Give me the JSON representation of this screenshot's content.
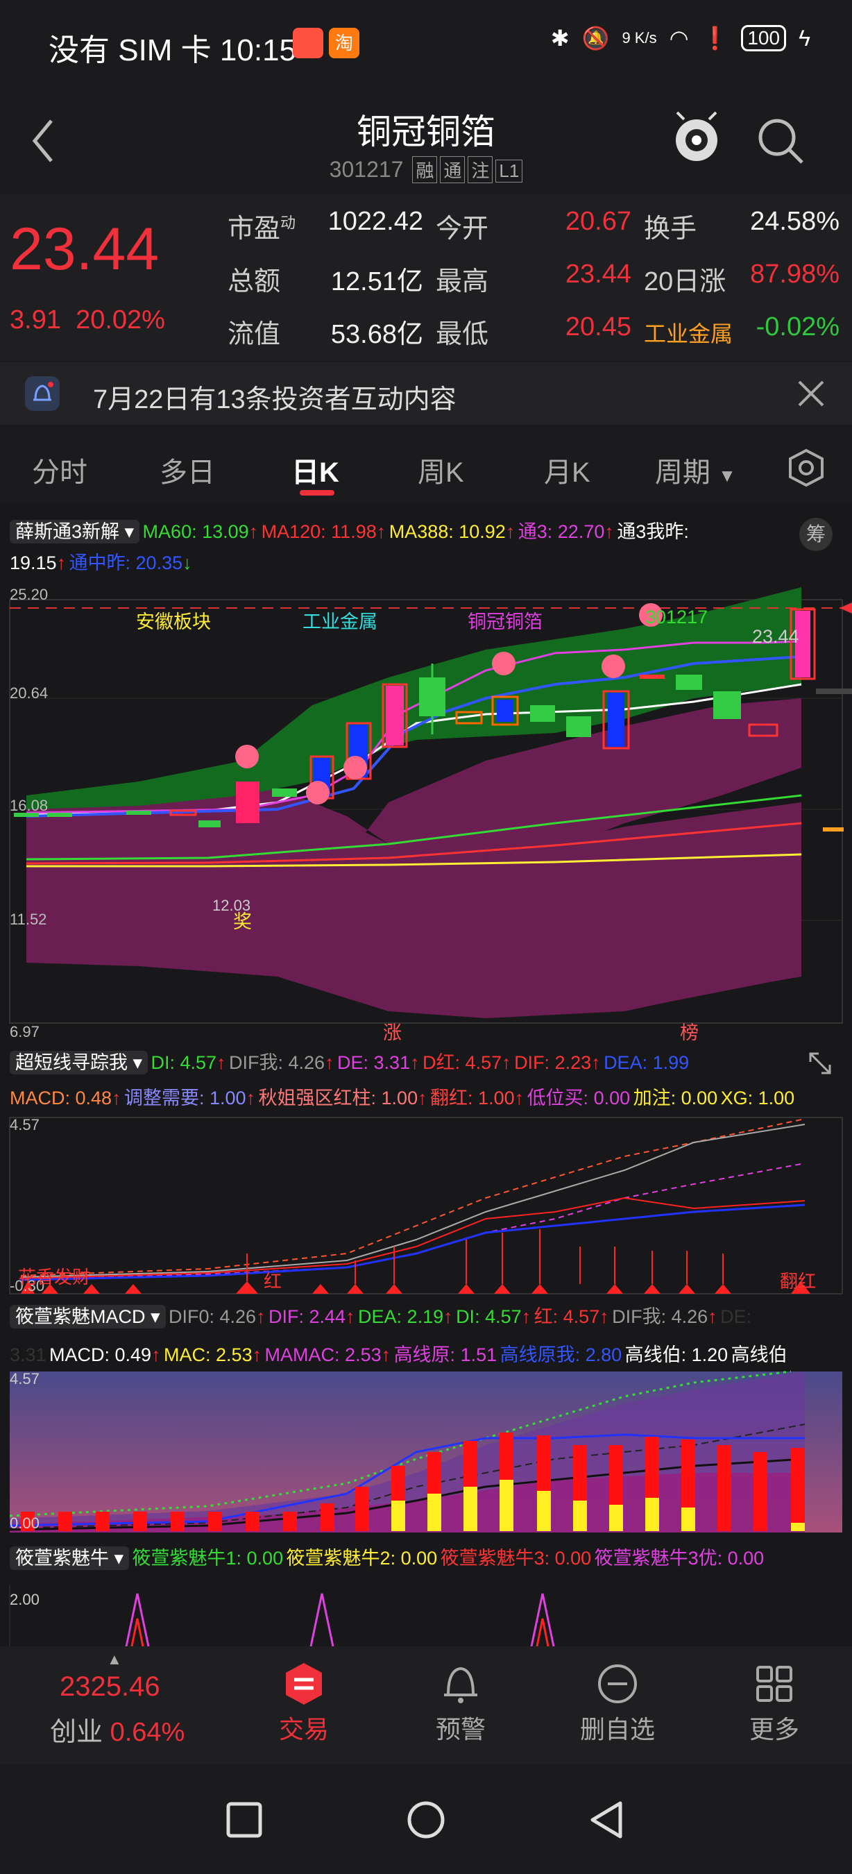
{
  "status_bar": {
    "left_text": "没有 SIM 卡 10:15",
    "network_speed": "9 K/s",
    "battery": "100"
  },
  "header": {
    "back_icon": "chevron-left-icon",
    "title": "铜冠铜箔",
    "code": "301217",
    "tags": [
      "融",
      "通",
      "注",
      "L1"
    ]
  },
  "quote": {
    "price": "23.44",
    "change": "3.91",
    "change_pct": "20.02%",
    "rows": [
      {
        "l1": "市盈",
        "sup": "动",
        "v1": "1022.42",
        "l2": "今开",
        "v2": "20.67",
        "l3": "换手",
        "v3": "24.58%"
      },
      {
        "l1": "总额",
        "v1": "12.51亿",
        "l2": "最高",
        "v2": "23.44",
        "l3": "20日涨",
        "v3": "87.98%"
      },
      {
        "l1": "流值",
        "v1": "53.68亿",
        "l2": "最低",
        "v2": "20.45",
        "l3": "工业金属",
        "v3": "-0.02%"
      }
    ]
  },
  "notice": {
    "text": "7月22日有13条投资者互动内容"
  },
  "tabs": [
    "分时",
    "多日",
    "日K",
    "周K",
    "月K",
    "周期"
  ],
  "main_panel": {
    "indicator": "薛斯通3新解",
    "legend": [
      {
        "text": "MA60: 13.09",
        "color": "#33dd33"
      },
      {
        "text": "MA120: 11.98",
        "color": "#ff3333"
      },
      {
        "text": "MA388: 10.92",
        "color": "#ffee33"
      },
      {
        "text": "通3: 22.70",
        "color": "#e040e0"
      },
      {
        "text": "通3我昨:",
        "color": "#ffffff"
      },
      {
        "text": "19.15",
        "color": "#ffffff"
      },
      {
        "text": "通中昨: 20.35",
        "color": "#3355ff"
      }
    ],
    "chou": "筹",
    "y_labels": [
      "25.20",
      "20.64",
      "16.08",
      "11.52",
      "6.97"
    ],
    "sector_labels": [
      {
        "text": "安徽板块",
        "color": "#ffee33"
      },
      {
        "text": "工业金属",
        "color": "#33dddd"
      },
      {
        "text": "铜冠铜箔",
        "color": "#e040e0"
      },
      {
        "text": "301217",
        "color": "#33dd33"
      }
    ],
    "last_price_label": "23.44",
    "low_label": "12.03",
    "award_label": "奖",
    "marker_zhang": "涨",
    "marker_bang": "榜"
  },
  "panel2": {
    "indicator": "超短线寻踪我",
    "legend1": [
      {
        "text": "DI: 4.57",
        "color": "#33dd33"
      },
      {
        "text": "DIF我: 4.26",
        "color": "#999999"
      },
      {
        "text": "DE: 3.31",
        "color": "#e040e0"
      },
      {
        "text": "D红: 4.57",
        "color": "#ff3333"
      },
      {
        "text": "DIF: 2.23",
        "color": "#ff3333"
      },
      {
        "text": "DEA: 1.99",
        "color": "#3355ff"
      }
    ],
    "legend2": [
      {
        "text": "MACD: 0.48",
        "color": "#ff8844"
      },
      {
        "text": "调整需要: 1.00",
        "color": "#8888ff"
      },
      {
        "text": "秋姐强区红柱: 1.00",
        "color": "#ff7777"
      },
      {
        "text": "翻红: 1.00",
        "color": "#ff4444"
      },
      {
        "text": "低位买: 0.00",
        "color": "#e040e0"
      },
      {
        "text": "加注: 0.00",
        "color": "#ffee33"
      },
      {
        "text": "XG: 1.00",
        "color": "#ffee33"
      }
    ],
    "y_top": "4.57",
    "y_bottom": "-0.30",
    "text_bl": "花香发财",
    "text_red": "红",
    "text_fanhong": "翻红"
  },
  "panel3": {
    "indicator": "筱萱紫魅MACD",
    "legend1": [
      {
        "text": "DIF0: 4.26",
        "color": "#999999"
      },
      {
        "text": "DIF: 2.44",
        "color": "#e040e0"
      },
      {
        "text": "DEA: 2.19",
        "color": "#33dd33"
      },
      {
        "text": "DI: 4.57",
        "color": "#33dd33"
      },
      {
        "text": "红: 4.57",
        "color": "#ff3333"
      },
      {
        "text": "DIF我: 4.26",
        "color": "#999999"
      },
      {
        "text": "DE:",
        "color": "#333333"
      }
    ],
    "legend2": [
      {
        "text": "3.31",
        "color": "#333333"
      },
      {
        "text": "MACD: 0.49",
        "color": "#ffffff"
      },
      {
        "text": "MAC: 2.53",
        "color": "#ffee33"
      },
      {
        "text": "MAMAC: 2.53",
        "color": "#e040e0"
      },
      {
        "text": "高线原: 1.51",
        "color": "#e040e0"
      },
      {
        "text": "高线原我: 2.80",
        "color": "#3355ff"
      },
      {
        "text": "高线伯: 1.20",
        "color": "#ffffff"
      },
      {
        "text": "高线伯",
        "color": "#ffffff"
      }
    ],
    "y_top": "4.57",
    "y_bottom": "0.00"
  },
  "panel4": {
    "indicator": "筱萱紫魅牛",
    "legend": [
      {
        "text": "筱萱紫魅牛1: 0.00",
        "color": "#33dd33"
      },
      {
        "text": "筱萱紫魅牛2: 0.00",
        "color": "#ffee33"
      },
      {
        "text": "筱萱紫魅牛3: 0.00",
        "color": "#ff3333"
      },
      {
        "text": "筱萱紫魅牛3优: 0.00",
        "color": "#e040e0"
      }
    ],
    "y_top": "2.00"
  },
  "bottom_nav": {
    "index_value": "2325.46",
    "index_name": "创业",
    "index_pct": "0.64%",
    "items": [
      {
        "label": "交易",
        "icon": "trade-icon"
      },
      {
        "label": "预警",
        "icon": "bell-icon"
      },
      {
        "label": "删自选",
        "icon": "minus-circle-icon"
      },
      {
        "label": "更多",
        "icon": "grid-icon"
      }
    ]
  },
  "colors": {
    "up": "#f0303a",
    "down": "#2fc93f",
    "accent": "#f0303a"
  }
}
